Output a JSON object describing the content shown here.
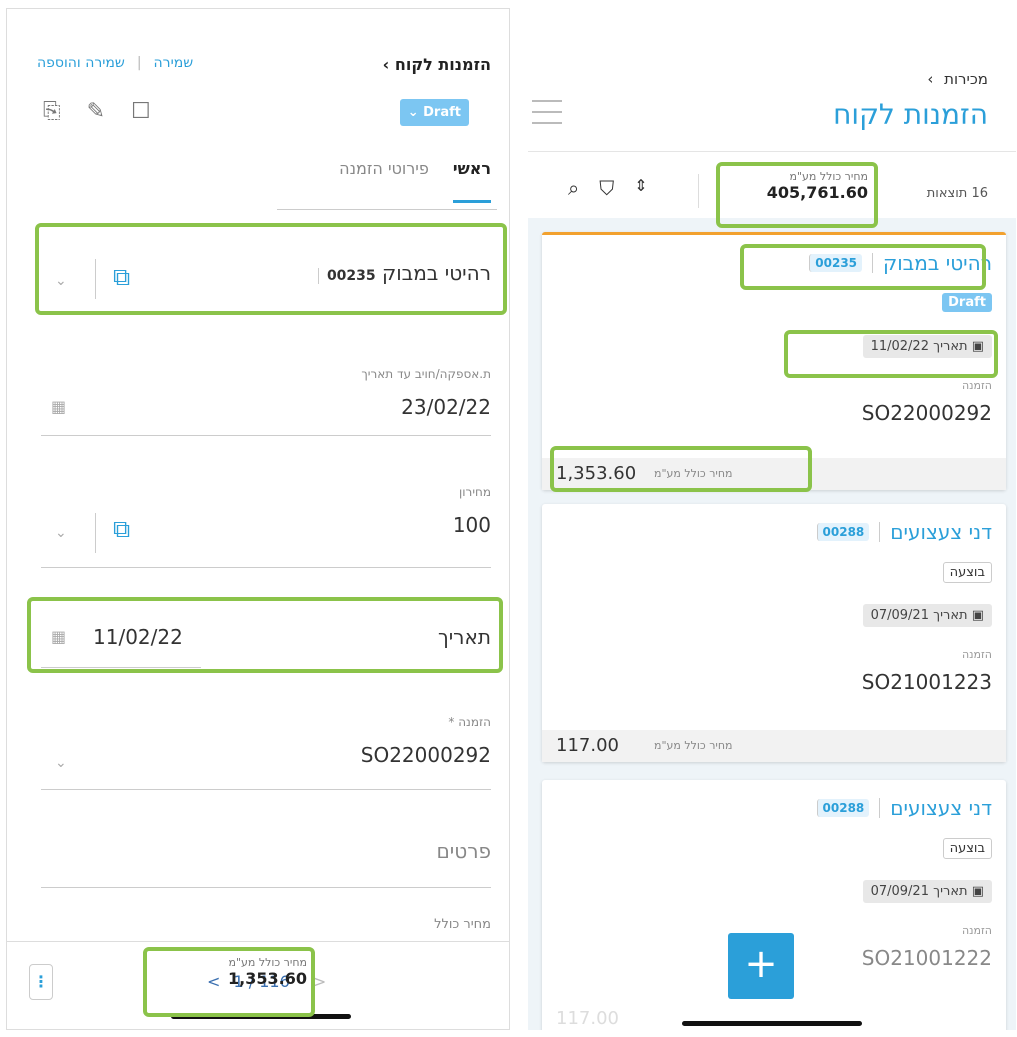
{
  "left": {
    "header": {
      "title": "הזמנות לקוח",
      "back_icon": "chevron-left-icon",
      "save_and_add": "שמירה והוספה",
      "separator": "|",
      "save": "שמירה",
      "status_button": "Draft",
      "status_chevron": "⌄",
      "icons": [
        "attachment-icon",
        "notes-icon",
        "comment-icon"
      ]
    },
    "tabs": [
      {
        "label": "ראשי"
      },
      {
        "label": "פירוטי הזמנה"
      }
    ],
    "customer": {
      "name": "רהיטי במבוק",
      "code": "00235"
    },
    "fields": {
      "delivery_label": "ת.אספקה/חויב עד תאריך",
      "delivery_value": "23/02/22",
      "pricelist_label": "מחירון",
      "pricelist_value": "100",
      "date_label": "תאריך",
      "date_value": "11/02/22",
      "order_label": "הזמנה *",
      "order_value": "SO22000292",
      "details_placeholder": "פרטים",
      "total_label": "מחיר כולל"
    },
    "footer": {
      "pager": "1 / 116",
      "prev": "<",
      "next": ">",
      "total_label": "מחיר כולל מע\"מ",
      "total_value": "1,353.60",
      "more": "⋮"
    }
  },
  "right": {
    "breadcrumb": "מכירות",
    "title": "הזמנות לקוח",
    "results": "16 תוצאות",
    "total_label": "מחיר כולל מע\"מ",
    "total_value": "405,761.60",
    "tools": {
      "search": "⌕",
      "filter": "⛉",
      "sort": "⇕"
    },
    "cards": [
      {
        "name": "רהיטי במבוק",
        "code": "00235",
        "status": "Draft",
        "date": "תאריך 11/02/22",
        "order_label": "הזמנה",
        "order": "SO22000292",
        "total_label": "מחיר כולל מע\"מ",
        "total": "1,353.60"
      },
      {
        "name": "דני צעצועים",
        "code": "00288",
        "status": "בוצעה",
        "date": "תאריך 07/09/21",
        "order_label": "הזמנה",
        "order": "SO21001223",
        "total_label": "מחיר כולל מע\"מ",
        "total": "117.00"
      },
      {
        "name": "דני צעצועים",
        "code": "00288",
        "status": "בוצעה",
        "date": "תאריך 07/09/21",
        "order_label": "הזמנה",
        "order": "SO21001222",
        "total": "117.00"
      }
    ],
    "fab": "+"
  },
  "colors": {
    "accent": "#2b9fd9",
    "highlight": "#8bc34a",
    "draft": "#7cc6f2",
    "selected_card_border": "#f2a12e"
  }
}
